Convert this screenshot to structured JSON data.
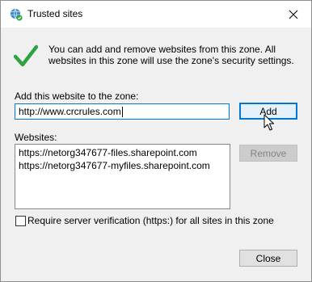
{
  "window": {
    "title": "Trusted sites",
    "title_icon": "globe-check-icon",
    "close_icon": "close-icon"
  },
  "info": {
    "icon": "checkmark-icon",
    "text": "You can add and remove websites from this zone. All websites in this zone will use the zone's security settings."
  },
  "add_section": {
    "label": "Add this website to the zone:",
    "input_value": "http://www.crcrules.com",
    "add_label": "Add"
  },
  "websites": {
    "label": "Websites:",
    "items": [
      "https://netorg347677-files.sharepoint.com",
      "https://netorg347677-myfiles.sharepoint.com"
    ],
    "remove_label": "Remove"
  },
  "verification": {
    "checked": false,
    "label": "Require server verification (https:) for all sites in this zone"
  },
  "footer": {
    "close_label": "Close"
  },
  "colors": {
    "accent": "#0078d7",
    "check_green": "#2fa343",
    "dialog_bg": "#f0f0f0"
  }
}
